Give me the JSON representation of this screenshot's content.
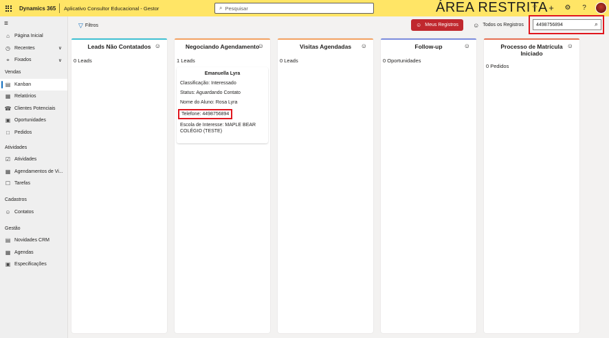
{
  "topbar": {
    "brand": "Dynamics 365",
    "app_name": "Aplicativo Consultor Educacional - Gestor",
    "search_placeholder": "Pesquisar",
    "banner": "ÁREA RESTRITA"
  },
  "sidebar": {
    "top_items": [
      {
        "label": "Página Inicial",
        "icon": "home-icon"
      },
      {
        "label": "Recentes",
        "icon": "clock-icon"
      },
      {
        "label": "Fixados",
        "icon": "pin-icon"
      }
    ],
    "sections": [
      {
        "title": "Vendas",
        "items": [
          "Kanban",
          "Relatórios",
          "Clientes Potenciais",
          "Oportunidades",
          "Pedidos"
        ]
      },
      {
        "title": "Atividades",
        "items": [
          "Atividades",
          "Agendamentos de Vi...",
          "Tarefas"
        ]
      },
      {
        "title": "Cadastros",
        "items": [
          "Contatos"
        ]
      },
      {
        "title": "Gestão",
        "items": [
          "Novidades CRM",
          "Agendas",
          "Especificações"
        ]
      }
    ]
  },
  "commandbar": {
    "filters_label": "Filtros",
    "my_records_label": "Meus Registros",
    "all_records_label": "Todos os Registros",
    "search_value": "4498756894"
  },
  "columns": [
    {
      "title": "Leads Não Contatados",
      "count": "0 Leads",
      "color": "#3ec1d3"
    },
    {
      "title": "Negociando Agendamento",
      "count": "1 Leads",
      "color": "#f4a261"
    },
    {
      "title": "Visitas Agendadas",
      "count": "0 Leads",
      "color": "#f4a261"
    },
    {
      "title": "Follow-up",
      "count": "0 Oportunidades",
      "color": "#7b8cde"
    },
    {
      "title": "Processo de Matrícula Iniciado",
      "count": "0 Pedidos",
      "color": "#e76f51"
    }
  ],
  "card": {
    "name": "Emanuella Lyra",
    "classification": "Classificação: Interessado",
    "status": "Status: Aguardando Contato",
    "student": "Nome do Aluno: Rosa Lyra",
    "phone": "Telefone: 4498756894",
    "school": "Escola de Interesse: MAPLE BEAR COLÉGIO (TESTE)"
  }
}
